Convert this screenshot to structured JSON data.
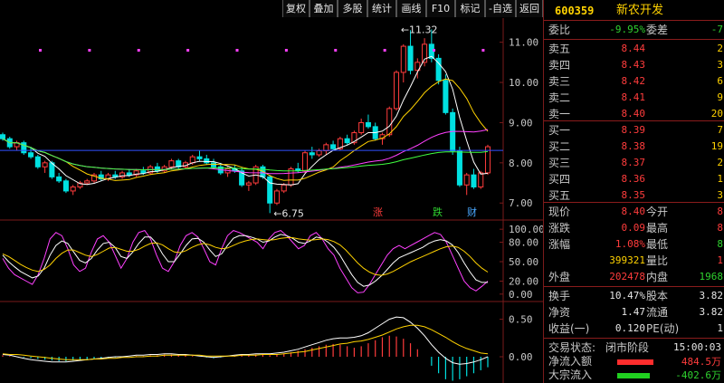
{
  "toolbar": {
    "buttons": [
      "复权",
      "叠加",
      "多股",
      "统计",
      "画线",
      "F10",
      "标记",
      "-自选",
      "返回"
    ]
  },
  "stock": {
    "code": "600359",
    "name": "新农开发"
  },
  "orderbook": {
    "weibi_label": "委比",
    "weibi_value": "-9.95%",
    "weicha_label": "委差",
    "weicha_value": "-7",
    "sells": [
      {
        "label": "卖五",
        "price": "8.44",
        "vol": "2"
      },
      {
        "label": "卖四",
        "price": "8.43",
        "vol": "3"
      },
      {
        "label": "卖三",
        "price": "8.42",
        "vol": "6"
      },
      {
        "label": "卖二",
        "price": "8.41",
        "vol": "9"
      },
      {
        "label": "卖一",
        "price": "8.40",
        "vol": "20"
      }
    ],
    "buys": [
      {
        "label": "买一",
        "price": "8.39",
        "vol": "7"
      },
      {
        "label": "买二",
        "price": "8.38",
        "vol": "19"
      },
      {
        "label": "买三",
        "price": "8.37",
        "vol": "2"
      },
      {
        "label": "买四",
        "price": "8.36",
        "vol": "1"
      },
      {
        "label": "买五",
        "price": "8.35",
        "vol": "3"
      }
    ]
  },
  "quote": {
    "xianjia_label": "现价",
    "xianjia": "8.40",
    "jinkai_label": "今开",
    "jinkai": "8",
    "zhangdie_label": "涨跌",
    "zhangdie": "0.09",
    "zuigao_label": "最高",
    "zuigao": "8",
    "zhangfu_label": "涨幅",
    "zhangfu": "1.08%",
    "zuidi_label": "最低",
    "zuidi": "8",
    "zongliang": "399321",
    "liangbi_label": "量比",
    "liangbi": "1",
    "waipan_label": "外盘",
    "waipan": "202478",
    "neipan_label": "内盘",
    "neipan": "1968",
    "huanshou_label": "换手",
    "huanshou": "10.47%",
    "guben_label": "股本",
    "guben": "3.82",
    "jingzi_label": "净资",
    "jingzi": "1.47",
    "liutong_label": "流通",
    "liutong": "3.82",
    "shouyi_label": "收益(一)",
    "shouyi": "0.120",
    "pe_label": "PE(动)",
    "pe": "1",
    "status_label": "交易状态:",
    "status": "闭市阶段",
    "time": "15:00:03",
    "jingliuru_label": "净流入额",
    "jingliuru": "484.5万",
    "dazong_label": "大宗流入",
    "dazong": "-402.6万"
  },
  "colors": {
    "up": "#ff3c3c",
    "down": "#00e0e0",
    "ma1": "#ffffff",
    "ma2": "#ffd200",
    "ma3": "#ff40ff",
    "ma4": "#40ff40",
    "grid": "#7a1a1a"
  },
  "chart_data": [
    {
      "type": "candlestick",
      "title": "",
      "y_ticks": [
        "11.00",
        "10.00",
        "9.00",
        "8.00",
        "7.00"
      ],
      "ylim": [
        6.6,
        11.6
      ],
      "annotations": [
        {
          "text": "11.32",
          "price": 11.32
        },
        {
          "text": "6.75",
          "price": 6.75
        }
      ],
      "markers": [
        "涨",
        "跌",
        "财"
      ],
      "candles": [
        [
          8.7,
          8.75,
          8.55,
          8.6
        ],
        [
          8.6,
          8.65,
          8.35,
          8.4
        ],
        [
          8.4,
          8.55,
          8.3,
          8.5
        ],
        [
          8.5,
          8.55,
          8.2,
          8.25
        ],
        [
          8.25,
          8.4,
          8.1,
          8.15
        ],
        [
          8.15,
          8.2,
          7.85,
          7.9
        ],
        [
          7.9,
          8.05,
          7.75,
          8.0
        ],
        [
          8.0,
          8.05,
          7.6,
          7.65
        ],
        [
          7.65,
          7.75,
          7.5,
          7.55
        ],
        [
          7.55,
          7.6,
          7.25,
          7.3
        ],
        [
          7.3,
          7.45,
          7.2,
          7.4
        ],
        [
          7.4,
          7.55,
          7.35,
          7.5
        ],
        [
          7.5,
          7.6,
          7.45,
          7.55
        ],
        [
          7.55,
          7.75,
          7.5,
          7.7
        ],
        [
          7.7,
          7.8,
          7.55,
          7.6
        ],
        [
          7.6,
          7.75,
          7.55,
          7.7
        ],
        [
          7.7,
          7.8,
          7.6,
          7.65
        ],
        [
          7.65,
          7.8,
          7.6,
          7.75
        ],
        [
          7.75,
          7.85,
          7.65,
          7.7
        ],
        [
          7.7,
          7.85,
          7.65,
          7.8
        ],
        [
          7.8,
          7.9,
          7.7,
          7.75
        ],
        [
          7.75,
          7.95,
          7.7,
          7.9
        ],
        [
          7.9,
          8.0,
          7.75,
          7.8
        ],
        [
          7.8,
          7.95,
          7.75,
          7.9
        ],
        [
          7.9,
          8.1,
          7.85,
          8.05
        ],
        [
          8.05,
          8.1,
          7.85,
          7.9
        ],
        [
          7.9,
          8.05,
          7.85,
          8.0
        ],
        [
          8.0,
          8.2,
          7.95,
          8.15
        ],
        [
          8.15,
          8.3,
          8.05,
          8.1
        ],
        [
          8.1,
          8.2,
          7.95,
          8.0
        ],
        [
          8.0,
          8.1,
          7.85,
          7.9
        ],
        [
          7.9,
          8.0,
          7.7,
          7.75
        ],
        [
          7.75,
          7.9,
          7.65,
          7.85
        ],
        [
          7.85,
          7.95,
          7.75,
          7.8
        ],
        [
          7.8,
          7.9,
          7.4,
          7.45
        ],
        [
          7.45,
          7.55,
          7.3,
          7.5
        ],
        [
          7.5,
          7.95,
          7.45,
          7.9
        ],
        [
          7.9,
          7.95,
          7.6,
          7.65
        ],
        [
          7.65,
          7.7,
          6.75,
          7.0
        ],
        [
          7.0,
          7.35,
          6.95,
          7.3
        ],
        [
          7.3,
          7.5,
          7.25,
          7.45
        ],
        [
          7.45,
          7.9,
          7.4,
          7.85
        ],
        [
          7.85,
          8.0,
          7.75,
          7.8
        ],
        [
          7.8,
          8.3,
          7.75,
          8.25
        ],
        [
          8.25,
          8.4,
          8.1,
          8.2
        ],
        [
          8.2,
          8.35,
          8.15,
          8.3
        ],
        [
          8.3,
          8.5,
          8.2,
          8.45
        ],
        [
          8.45,
          8.55,
          8.3,
          8.35
        ],
        [
          8.35,
          8.65,
          8.3,
          8.6
        ],
        [
          8.6,
          8.7,
          8.45,
          8.5
        ],
        [
          8.5,
          8.8,
          8.45,
          8.75
        ],
        [
          8.75,
          9.1,
          8.7,
          9.0
        ],
        [
          9.0,
          9.2,
          8.85,
          8.9
        ],
        [
          8.9,
          9.0,
          8.55,
          8.6
        ],
        [
          8.6,
          8.75,
          8.45,
          8.7
        ],
        [
          8.7,
          9.4,
          8.65,
          9.35
        ],
        [
          9.35,
          10.3,
          9.3,
          10.25
        ],
        [
          10.25,
          10.95,
          10.0,
          10.9
        ],
        [
          10.9,
          11.3,
          10.2,
          10.3
        ],
        [
          10.3,
          10.6,
          10.1,
          10.5
        ],
        [
          10.5,
          11.1,
          10.4,
          10.95
        ],
        [
          10.95,
          11.32,
          10.5,
          10.6
        ],
        [
          10.6,
          10.7,
          9.95,
          10.05
        ],
        [
          10.05,
          10.2,
          9.2,
          9.25
        ],
        [
          9.25,
          9.35,
          8.2,
          8.3
        ],
        [
          8.3,
          8.4,
          7.4,
          7.45
        ],
        [
          7.45,
          7.75,
          7.2,
          7.7
        ],
        [
          7.7,
          7.85,
          7.35,
          7.4
        ],
        [
          7.4,
          7.8,
          7.35,
          7.75
        ],
        [
          7.75,
          8.45,
          7.7,
          8.4
        ]
      ],
      "ma_series": [
        {
          "color": "ma1"
        },
        {
          "color": "ma2"
        },
        {
          "color": "ma3"
        },
        {
          "color": "ma4"
        }
      ]
    },
    {
      "type": "line",
      "y_ticks": [
        "100.00",
        "80.00",
        "50.00",
        "20.00",
        "0.00"
      ],
      "ylim": [
        -10,
        110
      ],
      "series": [
        {
          "color": "ma3",
          "values": [
            55,
            40,
            30,
            25,
            20,
            15,
            30,
            55,
            85,
            95,
            90,
            70,
            45,
            35,
            40,
            65,
            85,
            90,
            80,
            60,
            40,
            55,
            80,
            95,
            98,
            85,
            60,
            40,
            35,
            50,
            75,
            90,
            95,
            88,
            70,
            50,
            45,
            70,
            90,
            98,
            95,
            90,
            85,
            80,
            70,
            85,
            95,
            98,
            90,
            80,
            70,
            75,
            90,
            95,
            85,
            70,
            60,
            40,
            25,
            10,
            2,
            3,
            15,
            30,
            45,
            60,
            70,
            75,
            70,
            75,
            80,
            85,
            90,
            95,
            92,
            80,
            60,
            40,
            20,
            10,
            5,
            12,
            20
          ]
        },
        {
          "color": "ma1",
          "values": [
            60,
            50,
            42,
            35,
            30,
            25,
            28,
            40,
            60,
            75,
            82,
            78,
            65,
            52,
            48,
            55,
            68,
            78,
            80,
            72,
            58,
            55,
            65,
            78,
            88,
            88,
            78,
            62,
            50,
            50,
            62,
            75,
            85,
            86,
            80,
            68,
            58,
            62,
            75,
            86,
            90,
            90,
            88,
            85,
            80,
            82,
            88,
            92,
            90,
            86,
            80,
            78,
            82,
            88,
            86,
            80,
            72,
            60,
            45,
            30,
            18,
            12,
            14,
            20,
            28,
            38,
            48,
            56,
            60,
            64,
            68,
            72,
            78,
            82,
            84,
            82,
            76,
            64,
            48,
            34,
            22,
            18,
            18
          ]
        },
        {
          "color": "ma2",
          "values": [
            62,
            58,
            52,
            46,
            41,
            37,
            35,
            38,
            45,
            55,
            63,
            68,
            68,
            64,
            60,
            58,
            61,
            66,
            71,
            72,
            69,
            66,
            66,
            69,
            74,
            78,
            79,
            76,
            70,
            65,
            64,
            67,
            72,
            76,
            78,
            76,
            72,
            70,
            71,
            75,
            79,
            82,
            84,
            85,
            84,
            83,
            84,
            86,
            87,
            87,
            85,
            84,
            83,
            84,
            85,
            84,
            81,
            76,
            68,
            58,
            48,
            40,
            34,
            30,
            29,
            31,
            35,
            40,
            45,
            50,
            54,
            58,
            62,
            66,
            70,
            73,
            74,
            72,
            66,
            58,
            48,
            40,
            34
          ]
        }
      ]
    },
    {
      "type": "bar",
      "y_ticks": [
        "0.50",
        "0.00"
      ],
      "ylim": [
        -0.35,
        0.7
      ],
      "values": [
        0.02,
        0.01,
        0.0,
        -0.01,
        -0.02,
        -0.03,
        -0.04,
        -0.05,
        -0.06,
        -0.06,
        -0.05,
        -0.05,
        -0.04,
        -0.03,
        -0.02,
        -0.02,
        -0.01,
        -0.01,
        0.0,
        0.01,
        0.01,
        0.02,
        0.02,
        0.03,
        0.03,
        0.02,
        0.02,
        0.01,
        0.0,
        -0.01,
        -0.02,
        -0.01,
        0.0,
        0.01,
        0.02,
        0.02,
        0.03,
        0.03,
        0.02,
        0.03,
        0.04,
        0.06,
        0.08,
        0.1,
        0.12,
        0.14,
        0.16,
        0.17,
        0.16,
        0.14,
        0.12,
        0.14,
        0.18,
        0.22,
        0.26,
        0.28,
        0.27,
        0.24,
        0.18,
        0.1,
        0.0,
        -0.12,
        -0.22,
        -0.3,
        -0.32,
        -0.3,
        -0.26,
        -0.22,
        -0.18,
        -0.14
      ],
      "dif": [
        0.03,
        0.02,
        0.0,
        -0.02,
        -0.04,
        -0.05,
        -0.06,
        -0.07,
        -0.07,
        -0.07,
        -0.06,
        -0.05,
        -0.04,
        -0.03,
        -0.02,
        -0.01,
        0.0,
        0.0,
        0.01,
        0.02,
        0.02,
        0.03,
        0.03,
        0.04,
        0.04,
        0.03,
        0.03,
        0.02,
        0.01,
        0.0,
        -0.01,
        0.0,
        0.01,
        0.02,
        0.03,
        0.03,
        0.04,
        0.04,
        0.04,
        0.05,
        0.06,
        0.08,
        0.1,
        0.13,
        0.16,
        0.19,
        0.22,
        0.24,
        0.25,
        0.25,
        0.26,
        0.28,
        0.32,
        0.38,
        0.44,
        0.5,
        0.53,
        0.52,
        0.46,
        0.38,
        0.28,
        0.16,
        0.06,
        -0.02,
        -0.08,
        -0.1,
        -0.09,
        -0.07,
        -0.04,
        0.0
      ],
      "dea": [
        0.04,
        0.03,
        0.03,
        0.02,
        0.01,
        0.0,
        -0.01,
        -0.02,
        -0.03,
        -0.04,
        -0.04,
        -0.04,
        -0.04,
        -0.03,
        -0.03,
        -0.02,
        -0.02,
        -0.01,
        -0.01,
        0.0,
        0.0,
        0.01,
        0.01,
        0.02,
        0.02,
        0.02,
        0.02,
        0.02,
        0.02,
        0.01,
        0.01,
        0.01,
        0.01,
        0.01,
        0.02,
        0.02,
        0.02,
        0.03,
        0.03,
        0.03,
        0.04,
        0.05,
        0.06,
        0.07,
        0.09,
        0.11,
        0.13,
        0.15,
        0.17,
        0.18,
        0.2,
        0.21,
        0.23,
        0.26,
        0.29,
        0.33,
        0.37,
        0.4,
        0.42,
        0.42,
        0.4,
        0.36,
        0.31,
        0.26,
        0.2,
        0.15,
        0.11,
        0.08,
        0.05,
        0.04
      ]
    }
  ]
}
